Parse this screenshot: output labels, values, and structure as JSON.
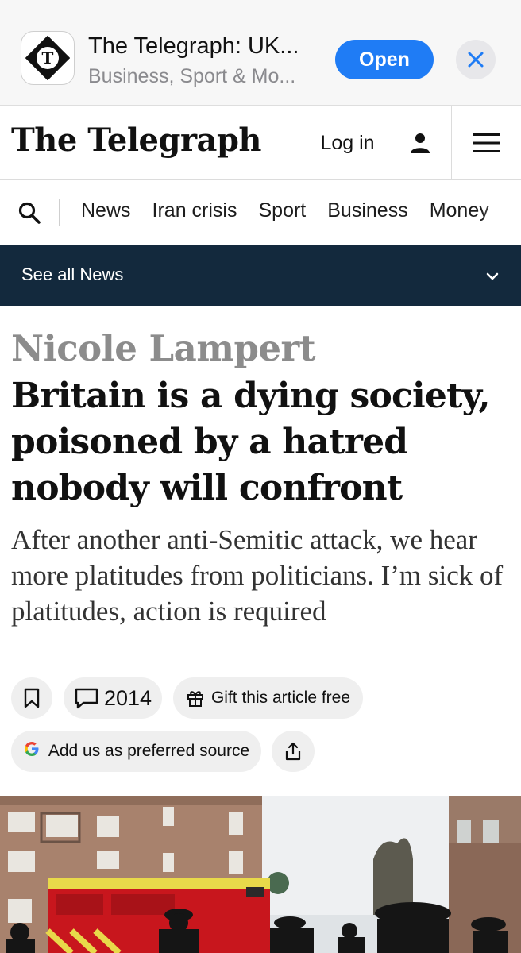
{
  "app_banner": {
    "name": "The Telegraph: UK...",
    "subtitle": "Business, Sport & Mo...",
    "open_label": "Open",
    "icon": "telegraph-t-logo",
    "open_color": "#1f7cf5"
  },
  "header": {
    "logo": "The Telegraph",
    "login_label": "Log in",
    "user_icon": "person-icon",
    "menu_icon": "hamburger-menu-icon"
  },
  "nav": {
    "items": [
      "News",
      "Iran crisis",
      "Sport",
      "Business",
      "Money"
    ]
  },
  "section_bar": {
    "label": "See all News",
    "background": "#13293d"
  },
  "article": {
    "author": "Nicole Lampert",
    "headline": "Britain is a dying society, poisoned by a hatred nobody will confront",
    "standfirst": "After another anti-Semitic attack, we hear more platitudes from politicians. I’m sick of platitudes, action is required",
    "comment_count": "2014",
    "gift_label": "Gift this article free",
    "preferred_source_label": "Add us as preferred source"
  }
}
